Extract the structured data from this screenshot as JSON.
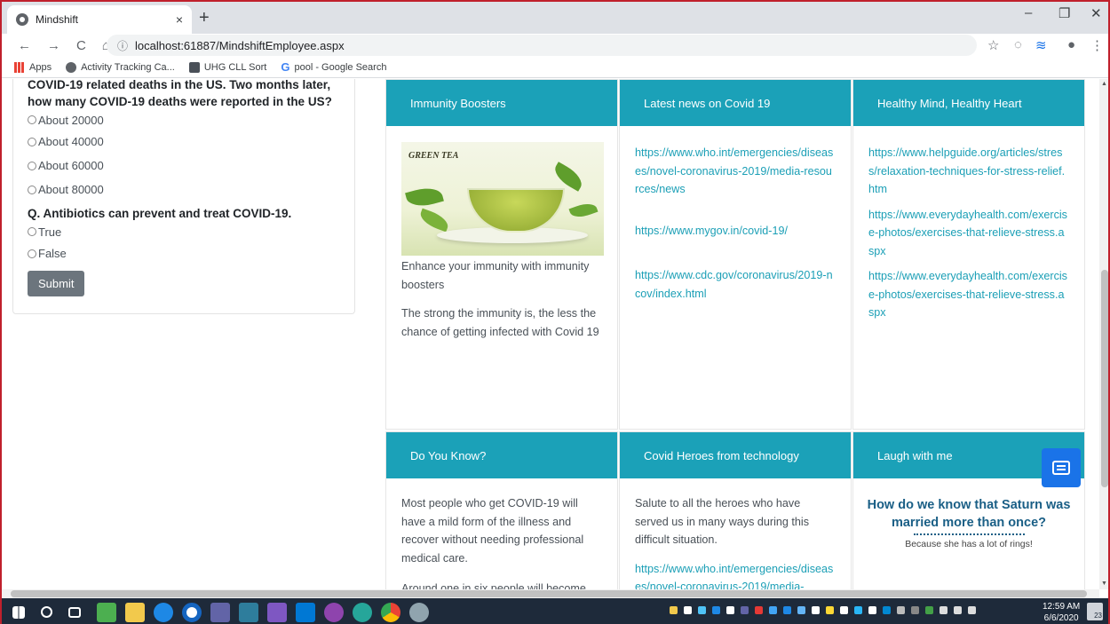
{
  "browser": {
    "tab_title": "Mindshift",
    "tab_close": "×",
    "new_tab": "+",
    "url": "localhost:61887/MindshiftEmployee.aspx",
    "window_controls": {
      "minimize": "–",
      "restore": "❐",
      "close": "✕"
    },
    "nav": {
      "back": "←",
      "forward": "→",
      "reload": "C",
      "home": "⌂"
    },
    "bookmarks": [
      {
        "label": "Apps",
        "icon": "apps-icon"
      },
      {
        "label": "Activity Tracking Ca...",
        "icon": "globe-icon"
      },
      {
        "label": "UHG CLL Sort",
        "icon": "bookmark-icon"
      },
      {
        "label": "pool - Google Search",
        "icon": "google-icon"
      }
    ]
  },
  "quiz": {
    "question1_partial": "COVID-19 related deaths in the US. Two months later, how many COVID-19 deaths were reported in the US?",
    "question1_options": [
      "About 20000",
      "About 40000",
      "About 60000",
      "About 80000"
    ],
    "question2": "Q. Antibiotics can prevent and treat COVID-19.",
    "question2_options": [
      "True",
      "False"
    ],
    "submit_label": "Submit"
  },
  "cards": {
    "immunity": {
      "header": "Immunity Boosters",
      "image_label": "GREEN TEA",
      "paragraphs": [
        "Enhance your immunity with immunity boosters",
        "The strong the immunity is, the less the chance of getting infected with Covid 19"
      ]
    },
    "news": {
      "header": "Latest news on Covid 19",
      "links": [
        "https://www.who.int/emergencies/diseases/novel-coronavirus-2019/media-resources/news",
        "https://www.mygov.in/covid-19/",
        "https://www.cdc.gov/coronavirus/2019-ncov/index.html"
      ]
    },
    "healthy": {
      "header": "Healthy Mind, Healthy Heart",
      "links": [
        "https://www.helpguide.org/articles/stress/relaxation-techniques-for-stress-relief.htm",
        "https://www.everydayhealth.com/exercise-photos/exercises-that-relieve-stress.aspx",
        "https://www.everydayhealth.com/exercise-photos/exercises-that-relieve-stress.aspx"
      ]
    },
    "know": {
      "header": "Do You Know?",
      "paragraphs": [
        "Most people who get COVID-19 will have a mild form of the illness and recover without needing professional medical care.",
        "Around one in six people will become"
      ]
    },
    "heroes": {
      "header": "Covid Heroes from technology",
      "paragraph": "Salute to all the heroes who have served us in many ways during this difficult situation.",
      "link": "https://www.who.int/emergencies/diseases/novel-coronavirus-2019/media-"
    },
    "laugh": {
      "header": "Laugh with me",
      "question": "How do we know that Saturn was married more than once?",
      "answer": "Because she has a lot of rings!"
    }
  },
  "taskbar": {
    "time": "12:59 AM",
    "date": "6/6/2020",
    "notification_count": "23"
  }
}
